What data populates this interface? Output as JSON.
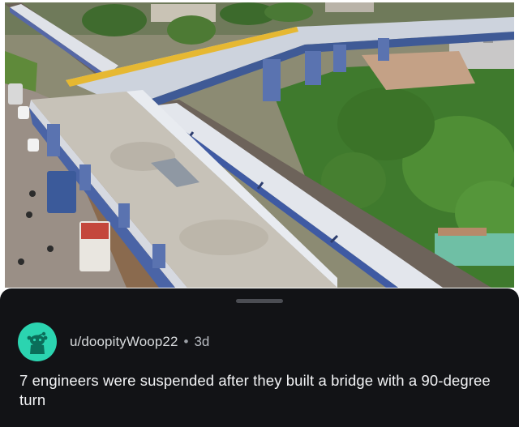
{
  "post": {
    "username": "u/doopityWoop22",
    "separator": "•",
    "age": "3d",
    "title": "7 engineers were suspended after they built a bridge with a 90-degree turn"
  },
  "media": {
    "kind": "aerial-photo",
    "subject": "elevated-bridge-over-railway"
  },
  "icons": {
    "avatar": "reddit-snoo-icon",
    "handle": "drag-handle-icon"
  },
  "colors": {
    "sheet_background": "#121316",
    "avatar_background": "#2bd4b0",
    "title_text": "#f2f3f5",
    "meta_text": "#b8bcc2"
  }
}
